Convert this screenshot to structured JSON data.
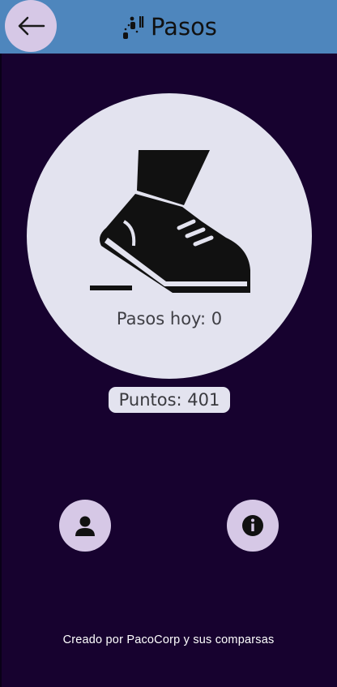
{
  "appbar": {
    "title": "Pasos",
    "back_icon": "arrow-left-icon",
    "title_icon": "footsteps-icon"
  },
  "main": {
    "illustration_icon": "sneaker-step-icon",
    "steps_today": "Pasos hoy: 0",
    "points": "Puntos: 401"
  },
  "actions": {
    "profile_icon": "person-icon",
    "info_icon": "info-icon"
  },
  "footer": {
    "credit": "Creado por PacoCorp y sus comparsas"
  },
  "colors": {
    "background": "#17022f",
    "appbar": "#4e86bd",
    "button": "#d6c8e6",
    "circle": "#e3e3ef"
  }
}
